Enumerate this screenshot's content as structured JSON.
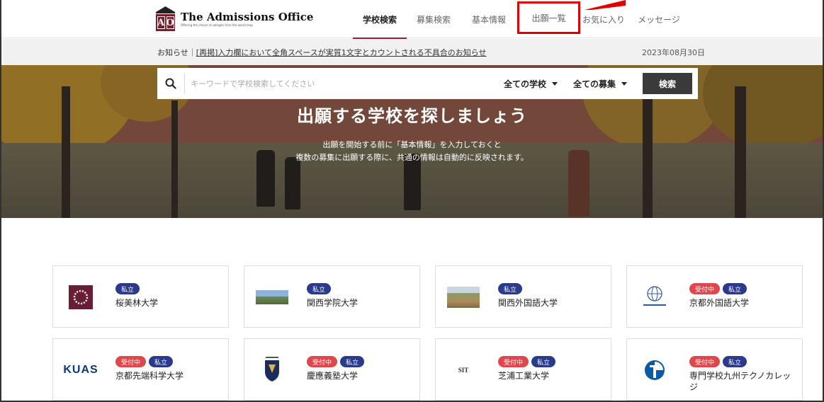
{
  "header": {
    "logo_title": "The Admissions Office",
    "logo_sub": "Offering the choice of colleges from the world map",
    "logo_letters": [
      "A",
      "O"
    ],
    "nav": [
      {
        "label": "学校検索",
        "active": true
      },
      {
        "label": "募集検索",
        "active": false
      },
      {
        "label": "基本情報",
        "active": false
      },
      {
        "label": "出願一覧",
        "active": false,
        "highlighted": true
      },
      {
        "label": "お気に入り",
        "active": false
      },
      {
        "label": "メッセージ",
        "active": false
      }
    ]
  },
  "notice": {
    "prefix": "お知らせ｜",
    "link": "[再掲]入力欄において全角スペースが実質1文字とカウントされる不具合のお知らせ",
    "date": "2023年08月30日"
  },
  "search": {
    "placeholder": "キーワードで学校検索してください",
    "school_filter": "全ての学校",
    "recruit_filter": "全ての募集",
    "button": "検索"
  },
  "hero": {
    "title": "出願する学校を探しましょう",
    "desc_line1": "出願を開始する前に「基本情報」を入力しておくと",
    "desc_line2": "複数の募集に出願する際に、共通の情報は自動的に反映されます。"
  },
  "cards": [
    {
      "name": "桜美林大学",
      "badges": [
        "私立"
      ],
      "logo": "obirin-wreath-icon"
    },
    {
      "name": "関西学院大学",
      "badges": [
        "私立"
      ],
      "logo": "kwansei-campus-photo"
    },
    {
      "name": "関西外国語大学",
      "badges": [
        "私立"
      ],
      "logo": "kansai-gaidai-campus-photo"
    },
    {
      "name": "京都外国語大学",
      "badges": [
        "受付中",
        "私立"
      ],
      "logo": "kufs-globe-icon"
    },
    {
      "name": "京都先端科学大学",
      "badges": [
        "受付中",
        "私立"
      ],
      "logo": "KUAS"
    },
    {
      "name": "慶應義塾大学",
      "badges": [
        "受付中",
        "私立"
      ],
      "logo": "keio-crest-icon"
    },
    {
      "name": "芝浦工業大学",
      "badges": [
        "受付中",
        "私立"
      ],
      "logo": "SIT"
    },
    {
      "name": "専門学校九州テクノカレッジ",
      "badges": [
        "受付中",
        "私立"
      ],
      "logo": "kyushu-techno-icon"
    }
  ],
  "colors": {
    "brand": "#7a1e2c",
    "badge_public": "#2b3a8c",
    "badge_open": "#e0474c",
    "highlight": "#e00000"
  }
}
